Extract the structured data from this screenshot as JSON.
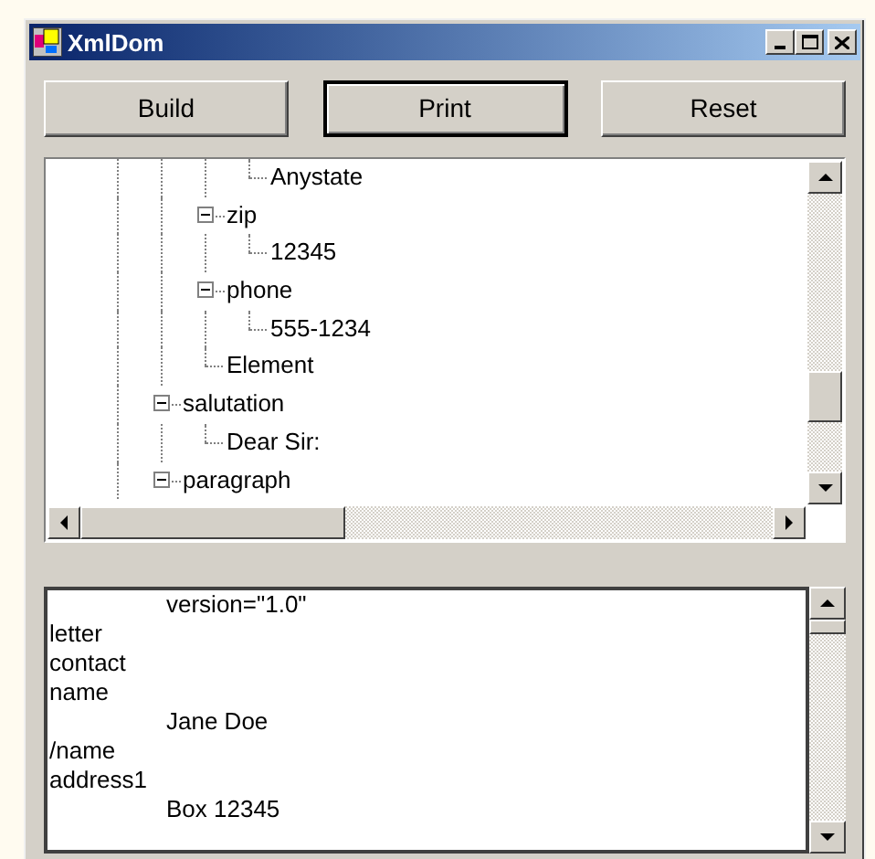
{
  "window": {
    "title": "XmlDom"
  },
  "buttons": [
    {
      "label": "Build",
      "default": false
    },
    {
      "label": "Print",
      "default": true
    },
    {
      "label": "Reset",
      "default": false
    }
  ],
  "tree": {
    "items": [
      {
        "children": [
          {
            "children": [
              {
                "children": [
                  {
                    "label": "Anystate"
                  }
                ]
              },
              {
                "label": "zip",
                "expanded": true,
                "children": [
                  {
                    "label": "12345"
                  }
                ]
              },
              {
                "label": "phone",
                "expanded": true,
                "children": [
                  {
                    "label": "555-1234"
                  }
                ]
              },
              {
                "label": "Element"
              }
            ]
          },
          {
            "label": "salutation",
            "expanded": true,
            "children": [
              {
                "label": "Dear Sir:"
              }
            ]
          },
          {
            "label": "paragraph",
            "expanded": true
          }
        ]
      }
    ]
  },
  "output": {
    "lines": [
      {
        "text": "version=\"1.0\"",
        "indented": true
      },
      {
        "text": "letter",
        "indented": false
      },
      {
        "text": "contact",
        "indented": false
      },
      {
        "text": "name",
        "indented": false
      },
      {
        "text": "Jane Doe",
        "indented": true
      },
      {
        "text": "/name",
        "indented": false
      },
      {
        "text": "address1",
        "indented": false
      },
      {
        "text": "Box 12345",
        "indented": true
      }
    ]
  }
}
